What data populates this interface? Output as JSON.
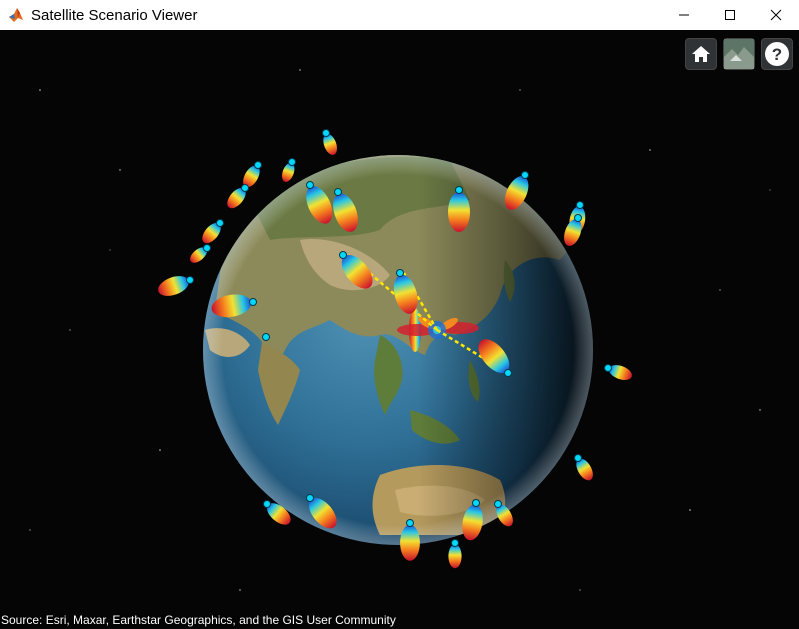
{
  "window": {
    "title": "Satellite Scenario Viewer"
  },
  "icons": {
    "app": "matlab-icon",
    "minimize": "minimize-icon",
    "maximize": "maximize-icon",
    "close": "close-icon",
    "home": "home-icon",
    "base_layer": "base-layer-picker-icon",
    "help": "help-icon"
  },
  "viewer": {
    "credit": "Source: Esri, Maxar, Earthstar Geographics, and the GIS User Community"
  },
  "colors": {
    "link": "#ffe600",
    "satellite_marker": "#00d8ff",
    "space": "#050505"
  }
}
